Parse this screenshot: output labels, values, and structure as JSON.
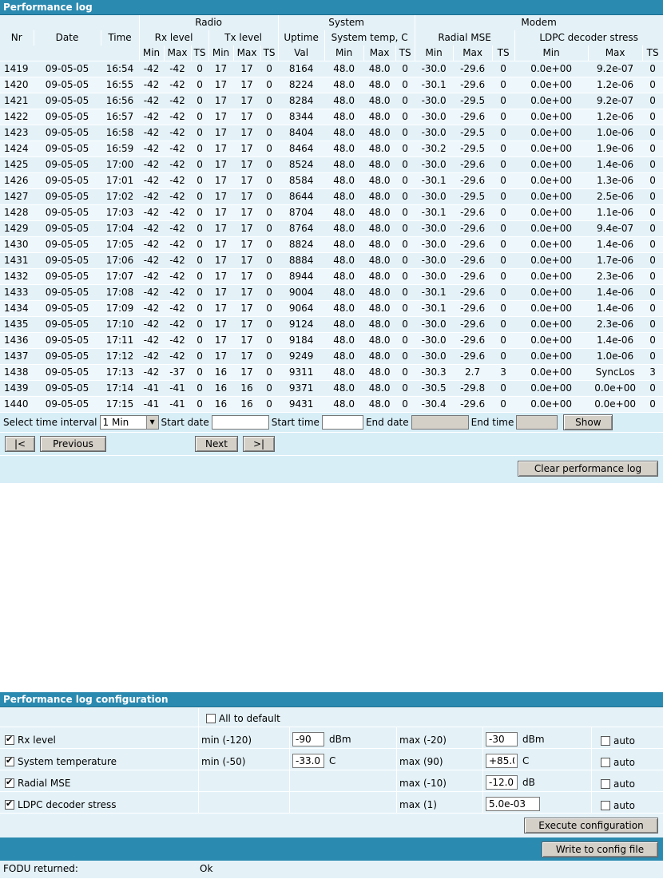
{
  "perf": {
    "title": "Performance log",
    "groups": {
      "radio": "Radio",
      "system": "System",
      "modem": "Modem"
    },
    "headers2": {
      "nr": "Nr",
      "date": "Date",
      "time": "Time",
      "rx": "Rx level",
      "tx": "Tx level",
      "uptime": "Uptime",
      "systemp": "System temp, C",
      "mse": "Radial MSE",
      "ldpc": "LDPC decoder stress"
    },
    "headers3": [
      "Min",
      "Max",
      "TS",
      "Min",
      "Max",
      "TS",
      "Val",
      "Min",
      "Max",
      "TS",
      "Min",
      "Max",
      "TS",
      "Min",
      "Max",
      "TS"
    ],
    "rows": [
      [
        "1419",
        "09-05-05",
        "16:54",
        "-42",
        "-42",
        "0",
        "17",
        "17",
        "0",
        "8164",
        "48.0",
        "48.0",
        "0",
        "-30.0",
        "-29.6",
        "0",
        "0.0e+00",
        "9.2e-07",
        "0"
      ],
      [
        "1420",
        "09-05-05",
        "16:55",
        "-42",
        "-42",
        "0",
        "17",
        "17",
        "0",
        "8224",
        "48.0",
        "48.0",
        "0",
        "-30.1",
        "-29.6",
        "0",
        "0.0e+00",
        "1.2e-06",
        "0"
      ],
      [
        "1421",
        "09-05-05",
        "16:56",
        "-42",
        "-42",
        "0",
        "17",
        "17",
        "0",
        "8284",
        "48.0",
        "48.0",
        "0",
        "-30.0",
        "-29.5",
        "0",
        "0.0e+00",
        "9.2e-07",
        "0"
      ],
      [
        "1422",
        "09-05-05",
        "16:57",
        "-42",
        "-42",
        "0",
        "17",
        "17",
        "0",
        "8344",
        "48.0",
        "48.0",
        "0",
        "-30.0",
        "-29.6",
        "0",
        "0.0e+00",
        "1.2e-06",
        "0"
      ],
      [
        "1423",
        "09-05-05",
        "16:58",
        "-42",
        "-42",
        "0",
        "17",
        "17",
        "0",
        "8404",
        "48.0",
        "48.0",
        "0",
        "-30.0",
        "-29.5",
        "0",
        "0.0e+00",
        "1.0e-06",
        "0"
      ],
      [
        "1424",
        "09-05-05",
        "16:59",
        "-42",
        "-42",
        "0",
        "17",
        "17",
        "0",
        "8464",
        "48.0",
        "48.0",
        "0",
        "-30.2",
        "-29.5",
        "0",
        "0.0e+00",
        "1.9e-06",
        "0"
      ],
      [
        "1425",
        "09-05-05",
        "17:00",
        "-42",
        "-42",
        "0",
        "17",
        "17",
        "0",
        "8524",
        "48.0",
        "48.0",
        "0",
        "-30.0",
        "-29.6",
        "0",
        "0.0e+00",
        "1.4e-06",
        "0"
      ],
      [
        "1426",
        "09-05-05",
        "17:01",
        "-42",
        "-42",
        "0",
        "17",
        "17",
        "0",
        "8584",
        "48.0",
        "48.0",
        "0",
        "-30.1",
        "-29.6",
        "0",
        "0.0e+00",
        "1.3e-06",
        "0"
      ],
      [
        "1427",
        "09-05-05",
        "17:02",
        "-42",
        "-42",
        "0",
        "17",
        "17",
        "0",
        "8644",
        "48.0",
        "48.0",
        "0",
        "-30.0",
        "-29.5",
        "0",
        "0.0e+00",
        "2.5e-06",
        "0"
      ],
      [
        "1428",
        "09-05-05",
        "17:03",
        "-42",
        "-42",
        "0",
        "17",
        "17",
        "0",
        "8704",
        "48.0",
        "48.0",
        "0",
        "-30.1",
        "-29.6",
        "0",
        "0.0e+00",
        "1.1e-06",
        "0"
      ],
      [
        "1429",
        "09-05-05",
        "17:04",
        "-42",
        "-42",
        "0",
        "17",
        "17",
        "0",
        "8764",
        "48.0",
        "48.0",
        "0",
        "-30.0",
        "-29.6",
        "0",
        "0.0e+00",
        "9.4e-07",
        "0"
      ],
      [
        "1430",
        "09-05-05",
        "17:05",
        "-42",
        "-42",
        "0",
        "17",
        "17",
        "0",
        "8824",
        "48.0",
        "48.0",
        "0",
        "-30.0",
        "-29.6",
        "0",
        "0.0e+00",
        "1.4e-06",
        "0"
      ],
      [
        "1431",
        "09-05-05",
        "17:06",
        "-42",
        "-42",
        "0",
        "17",
        "17",
        "0",
        "8884",
        "48.0",
        "48.0",
        "0",
        "-30.0",
        "-29.6",
        "0",
        "0.0e+00",
        "1.7e-06",
        "0"
      ],
      [
        "1432",
        "09-05-05",
        "17:07",
        "-42",
        "-42",
        "0",
        "17",
        "17",
        "0",
        "8944",
        "48.0",
        "48.0",
        "0",
        "-30.0",
        "-29.6",
        "0",
        "0.0e+00",
        "2.3e-06",
        "0"
      ],
      [
        "1433",
        "09-05-05",
        "17:08",
        "-42",
        "-42",
        "0",
        "17",
        "17",
        "0",
        "9004",
        "48.0",
        "48.0",
        "0",
        "-30.1",
        "-29.6",
        "0",
        "0.0e+00",
        "1.4e-06",
        "0"
      ],
      [
        "1434",
        "09-05-05",
        "17:09",
        "-42",
        "-42",
        "0",
        "17",
        "17",
        "0",
        "9064",
        "48.0",
        "48.0",
        "0",
        "-30.1",
        "-29.6",
        "0",
        "0.0e+00",
        "1.4e-06",
        "0"
      ],
      [
        "1435",
        "09-05-05",
        "17:10",
        "-42",
        "-42",
        "0",
        "17",
        "17",
        "0",
        "9124",
        "48.0",
        "48.0",
        "0",
        "-30.0",
        "-29.6",
        "0",
        "0.0e+00",
        "2.3e-06",
        "0"
      ],
      [
        "1436",
        "09-05-05",
        "17:11",
        "-42",
        "-42",
        "0",
        "17",
        "17",
        "0",
        "9184",
        "48.0",
        "48.0",
        "0",
        "-30.0",
        "-29.6",
        "0",
        "0.0e+00",
        "1.4e-06",
        "0"
      ],
      [
        "1437",
        "09-05-05",
        "17:12",
        "-42",
        "-42",
        "0",
        "17",
        "17",
        "0",
        "9249",
        "48.0",
        "48.0",
        "0",
        "-30.0",
        "-29.6",
        "0",
        "0.0e+00",
        "1.0e-06",
        "0"
      ],
      [
        "1438",
        "09-05-05",
        "17:13",
        "-42",
        "-37",
        "0",
        "16",
        "17",
        "0",
        "9311",
        "48.0",
        "48.0",
        "0",
        "-30.3",
        "2.7",
        "3",
        "0.0e+00",
        "SyncLos",
        "3"
      ],
      [
        "1439",
        "09-05-05",
        "17:14",
        "-41",
        "-41",
        "0",
        "16",
        "16",
        "0",
        "9371",
        "48.0",
        "48.0",
        "0",
        "-30.5",
        "-29.8",
        "0",
        "0.0e+00",
        "0.0e+00",
        "0"
      ],
      [
        "1440",
        "09-05-05",
        "17:15",
        "-41",
        "-41",
        "0",
        "16",
        "16",
        "0",
        "9431",
        "48.0",
        "48.0",
        "0",
        "-30.4",
        "-29.6",
        "0",
        "0.0e+00",
        "0.0e+00",
        "0"
      ]
    ],
    "controls": {
      "interval_label": "Select time interval",
      "interval_value": "1 Min",
      "start_date_label": "Start date",
      "start_date_value": "",
      "start_time_label": "Start time",
      "start_time_value": "",
      "end_date_label": "End date",
      "end_date_value": "",
      "end_time_label": "End time",
      "end_time_value": "",
      "show_label": "Show"
    },
    "nav": {
      "first": "|<",
      "previous": "Previous",
      "next": "Next",
      "last": ">|"
    },
    "clear_label": "Clear performance log"
  },
  "config": {
    "title": "Performance log configuration",
    "all_default_label": "All to default",
    "rows": [
      {
        "label": "Rx level",
        "checked": true,
        "min_label": "min (-120)",
        "min_value": "-90",
        "min_unit": "dBm",
        "max_label": "max (-20)",
        "max_value": "-30",
        "max_unit": "dBm",
        "auto_label": "auto"
      },
      {
        "label": "System temperature",
        "checked": true,
        "min_label": "min (-50)",
        "min_value": "-33.0",
        "min_unit": "C",
        "max_label": "max (90)",
        "max_value": "+85.0",
        "max_unit": "C",
        "auto_label": "auto"
      },
      {
        "label": "Radial MSE",
        "checked": true,
        "min_label": "",
        "min_value": "",
        "min_unit": "",
        "max_label": "max (-10)",
        "max_value": "-12.0",
        "max_unit": "dB",
        "auto_label": "auto"
      },
      {
        "label": "LDPC decoder stress",
        "checked": true,
        "min_label": "",
        "min_value": "",
        "min_unit": "",
        "max_label": "max (1)",
        "max_value": "5.0e-03",
        "max_unit": "",
        "auto_label": "auto"
      }
    ],
    "execute_label": "Execute configuration",
    "write_label": "Write to config file",
    "returned_label": "FODU returned:",
    "returned_value": "Ok"
  }
}
